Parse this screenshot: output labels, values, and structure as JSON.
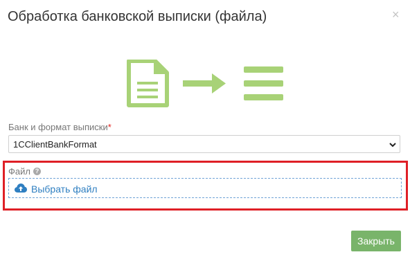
{
  "dialog": {
    "title": "Обработка банковской выписки (файла)",
    "close_symbol": "×"
  },
  "illustration": {
    "icons": [
      "document-icon",
      "arrow-right-icon",
      "list-icon"
    ],
    "color": "#a8d277"
  },
  "bank_format": {
    "label": "Банк и формат выписки",
    "required_marker": "*",
    "selected_value": "1CClientBankFormat"
  },
  "file": {
    "label": "Файл",
    "help_symbol": "?",
    "choose_label": "Выбрать файл",
    "highlight_color": "#df1f26"
  },
  "footer": {
    "close_label": "Закрыть",
    "close_color": "#79b46a"
  }
}
